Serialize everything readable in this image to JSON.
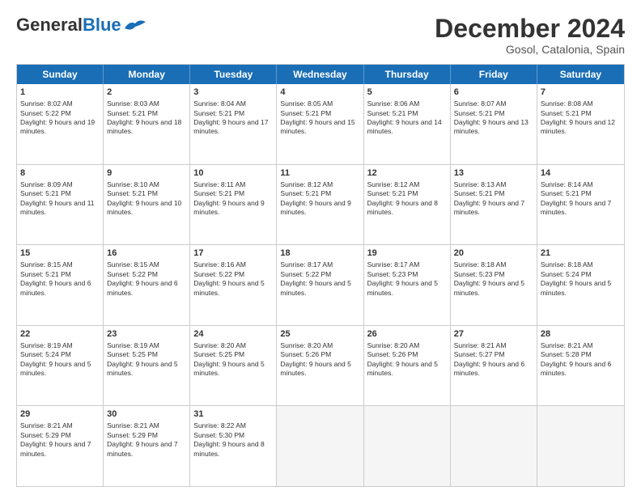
{
  "header": {
    "logo_general": "General",
    "logo_blue": "Blue",
    "month_title": "December 2024",
    "location": "Gosol, Catalonia, Spain"
  },
  "days_of_week": [
    "Sunday",
    "Monday",
    "Tuesday",
    "Wednesday",
    "Thursday",
    "Friday",
    "Saturday"
  ],
  "weeks": [
    [
      {
        "day": "1",
        "rise": "Sunrise: 8:02 AM",
        "set": "Sunset: 5:22 PM",
        "daylight": "Daylight: 9 hours and 19 minutes."
      },
      {
        "day": "2",
        "rise": "Sunrise: 8:03 AM",
        "set": "Sunset: 5:21 PM",
        "daylight": "Daylight: 9 hours and 18 minutes."
      },
      {
        "day": "3",
        "rise": "Sunrise: 8:04 AM",
        "set": "Sunset: 5:21 PM",
        "daylight": "Daylight: 9 hours and 17 minutes."
      },
      {
        "day": "4",
        "rise": "Sunrise: 8:05 AM",
        "set": "Sunset: 5:21 PM",
        "daylight": "Daylight: 9 hours and 15 minutes."
      },
      {
        "day": "5",
        "rise": "Sunrise: 8:06 AM",
        "set": "Sunset: 5:21 PM",
        "daylight": "Daylight: 9 hours and 14 minutes."
      },
      {
        "day": "6",
        "rise": "Sunrise: 8:07 AM",
        "set": "Sunset: 5:21 PM",
        "daylight": "Daylight: 9 hours and 13 minutes."
      },
      {
        "day": "7",
        "rise": "Sunrise: 8:08 AM",
        "set": "Sunset: 5:21 PM",
        "daylight": "Daylight: 9 hours and 12 minutes."
      }
    ],
    [
      {
        "day": "8",
        "rise": "Sunrise: 8:09 AM",
        "set": "Sunset: 5:21 PM",
        "daylight": "Daylight: 9 hours and 11 minutes."
      },
      {
        "day": "9",
        "rise": "Sunrise: 8:10 AM",
        "set": "Sunset: 5:21 PM",
        "daylight": "Daylight: 9 hours and 10 minutes."
      },
      {
        "day": "10",
        "rise": "Sunrise: 8:11 AM",
        "set": "Sunset: 5:21 PM",
        "daylight": "Daylight: 9 hours and 9 minutes."
      },
      {
        "day": "11",
        "rise": "Sunrise: 8:12 AM",
        "set": "Sunset: 5:21 PM",
        "daylight": "Daylight: 9 hours and 9 minutes."
      },
      {
        "day": "12",
        "rise": "Sunrise: 8:12 AM",
        "set": "Sunset: 5:21 PM",
        "daylight": "Daylight: 9 hours and 8 minutes."
      },
      {
        "day": "13",
        "rise": "Sunrise: 8:13 AM",
        "set": "Sunset: 5:21 PM",
        "daylight": "Daylight: 9 hours and 7 minutes."
      },
      {
        "day": "14",
        "rise": "Sunrise: 8:14 AM",
        "set": "Sunset: 5:21 PM",
        "daylight": "Daylight: 9 hours and 7 minutes."
      }
    ],
    [
      {
        "day": "15",
        "rise": "Sunrise: 8:15 AM",
        "set": "Sunset: 5:21 PM",
        "daylight": "Daylight: 9 hours and 6 minutes."
      },
      {
        "day": "16",
        "rise": "Sunrise: 8:15 AM",
        "set": "Sunset: 5:22 PM",
        "daylight": "Daylight: 9 hours and 6 minutes."
      },
      {
        "day": "17",
        "rise": "Sunrise: 8:16 AM",
        "set": "Sunset: 5:22 PM",
        "daylight": "Daylight: 9 hours and 5 minutes."
      },
      {
        "day": "18",
        "rise": "Sunrise: 8:17 AM",
        "set": "Sunset: 5:22 PM",
        "daylight": "Daylight: 9 hours and 5 minutes."
      },
      {
        "day": "19",
        "rise": "Sunrise: 8:17 AM",
        "set": "Sunset: 5:23 PM",
        "daylight": "Daylight: 9 hours and 5 minutes."
      },
      {
        "day": "20",
        "rise": "Sunrise: 8:18 AM",
        "set": "Sunset: 5:23 PM",
        "daylight": "Daylight: 9 hours and 5 minutes."
      },
      {
        "day": "21",
        "rise": "Sunrise: 8:18 AM",
        "set": "Sunset: 5:24 PM",
        "daylight": "Daylight: 9 hours and 5 minutes."
      }
    ],
    [
      {
        "day": "22",
        "rise": "Sunrise: 8:19 AM",
        "set": "Sunset: 5:24 PM",
        "daylight": "Daylight: 9 hours and 5 minutes."
      },
      {
        "day": "23",
        "rise": "Sunrise: 8:19 AM",
        "set": "Sunset: 5:25 PM",
        "daylight": "Daylight: 9 hours and 5 minutes."
      },
      {
        "day": "24",
        "rise": "Sunrise: 8:20 AM",
        "set": "Sunset: 5:25 PM",
        "daylight": "Daylight: 9 hours and 5 minutes."
      },
      {
        "day": "25",
        "rise": "Sunrise: 8:20 AM",
        "set": "Sunset: 5:26 PM",
        "daylight": "Daylight: 9 hours and 5 minutes."
      },
      {
        "day": "26",
        "rise": "Sunrise: 8:20 AM",
        "set": "Sunset: 5:26 PM",
        "daylight": "Daylight: 9 hours and 5 minutes."
      },
      {
        "day": "27",
        "rise": "Sunrise: 8:21 AM",
        "set": "Sunset: 5:27 PM",
        "daylight": "Daylight: 9 hours and 6 minutes."
      },
      {
        "day": "28",
        "rise": "Sunrise: 8:21 AM",
        "set": "Sunset: 5:28 PM",
        "daylight": "Daylight: 9 hours and 6 minutes."
      }
    ],
    [
      {
        "day": "29",
        "rise": "Sunrise: 8:21 AM",
        "set": "Sunset: 5:29 PM",
        "daylight": "Daylight: 9 hours and 7 minutes."
      },
      {
        "day": "30",
        "rise": "Sunrise: 8:21 AM",
        "set": "Sunset: 5:29 PM",
        "daylight": "Daylight: 9 hours and 7 minutes."
      },
      {
        "day": "31",
        "rise": "Sunrise: 8:22 AM",
        "set": "Sunset: 5:30 PM",
        "daylight": "Daylight: 9 hours and 8 minutes."
      },
      null,
      null,
      null,
      null
    ]
  ]
}
